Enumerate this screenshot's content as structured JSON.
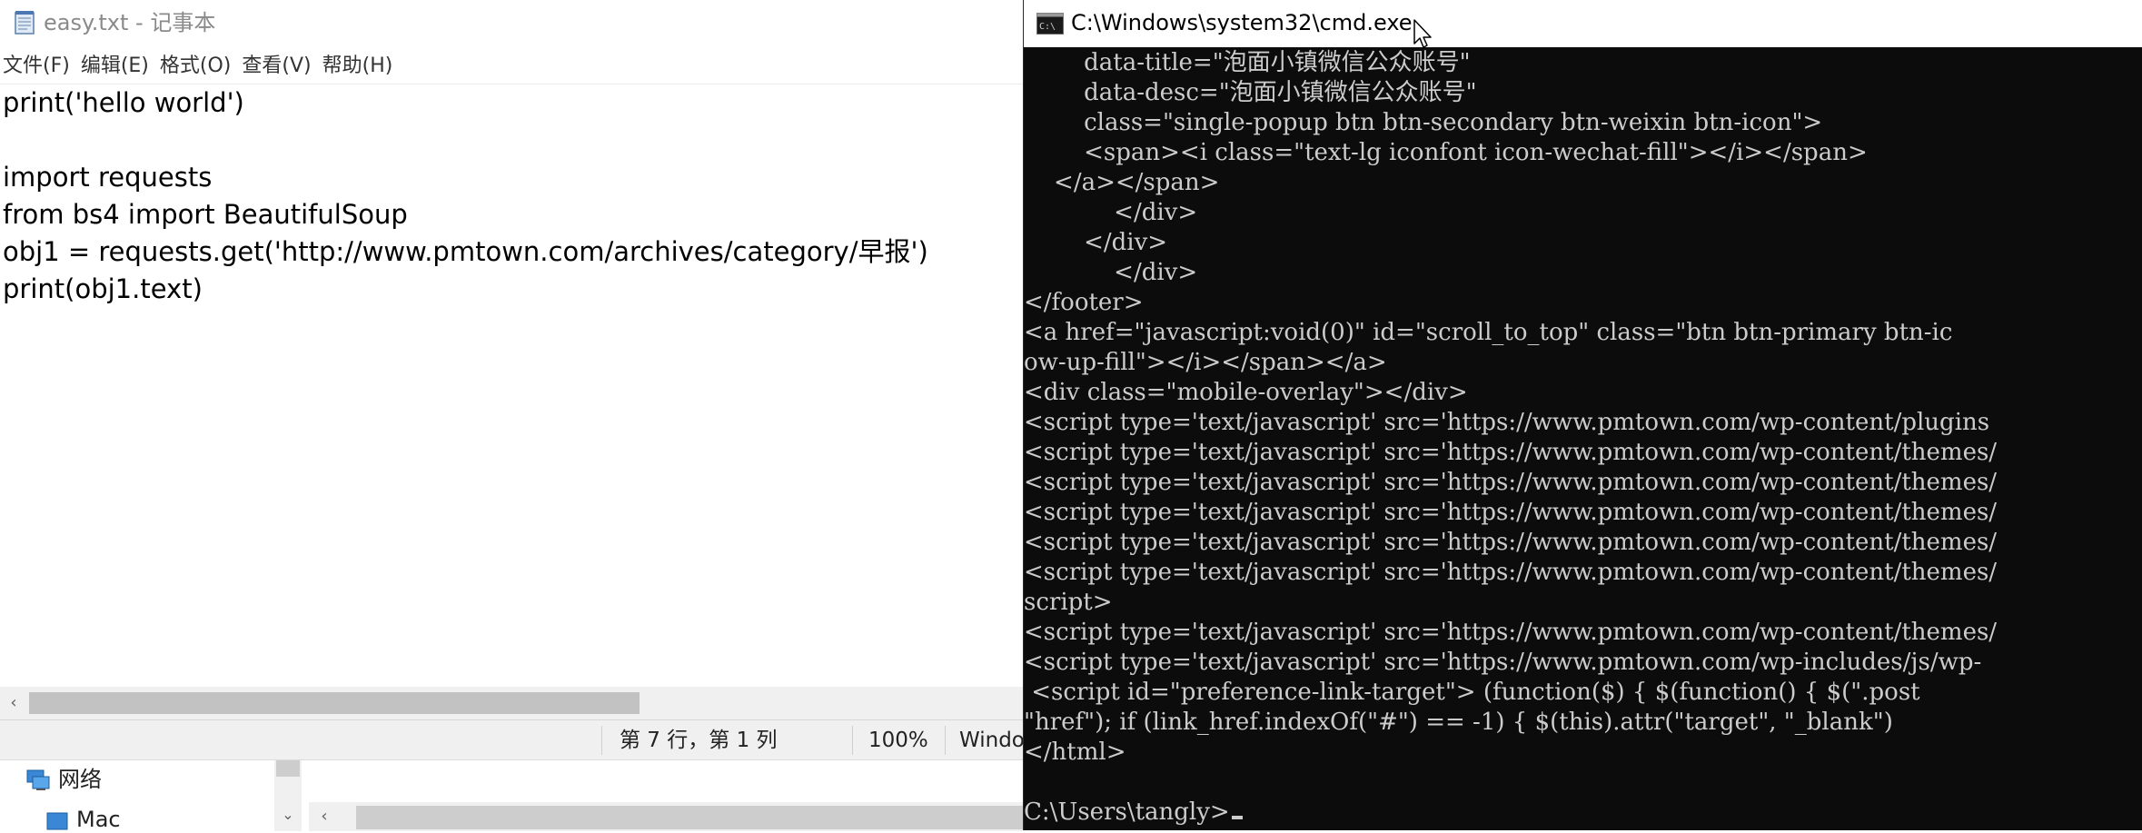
{
  "notepad": {
    "title": "easy.txt - 记事本",
    "menu": [
      "文件(F)",
      "编辑(E)",
      "格式(O)",
      "查看(V)",
      "帮助(H)"
    ],
    "lines": [
      "print('hello world')",
      "",
      "import requests",
      "from bs4 import BeautifulSoup",
      "obj1 = requests.get('http://www.pmtown.com/archives/category/早报')",
      "print(obj1.text)"
    ],
    "status": {
      "position": "第 7 行，第 1 列",
      "zoom": "100%",
      "line_ending": "Windo"
    }
  },
  "explorer": {
    "items": [
      {
        "label": "网络",
        "icon": "network-icon"
      },
      {
        "label": "Mac",
        "icon": "drive-icon"
      }
    ]
  },
  "cmd": {
    "title": "C:\\Windows\\system32\\cmd.exe",
    "lines": [
      "        data-title=\"泡面小镇微信公众账号\"",
      "        data-desc=\"泡面小镇微信公众账号\"",
      "        class=\"single-popup btn btn-secondary btn-weixin btn-icon\">",
      "        <span><i class=\"text-lg iconfont icon-wechat-fill\"></i></span>",
      "    </a></span>",
      "            </div>",
      "        </div>",
      "            </div>",
      "</footer>",
      "<a href=\"javascript:void(0)\" id=\"scroll_to_top\" class=\"btn btn-primary btn-ic",
      "ow-up-fill\"></i></span></a>",
      "<div class=\"mobile-overlay\"></div>",
      "<script type='text/javascript' src='https://www.pmtown.com/wp-content/plugins",
      "<script type='text/javascript' src='https://www.pmtown.com/wp-content/themes/",
      "<script type='text/javascript' src='https://www.pmtown.com/wp-content/themes/",
      "<script type='text/javascript' src='https://www.pmtown.com/wp-content/themes/",
      "<script type='text/javascript' src='https://www.pmtown.com/wp-content/themes/",
      "<script type='text/javascript' src='https://www.pmtown.com/wp-content/themes/",
      "script>",
      "<script type='text/javascript' src='https://www.pmtown.com/wp-content/themes/",
      "<script type='text/javascript' src='https://www.pmtown.com/wp-includes/js/wp-",
      " <script id=\"preference-link-target\"> (function($) { $(function() { $(\".post",
      "\"href\"); if (link_href.indexOf(\"#\") == -1) { $(this).attr(\"target\", \"_blank\")",
      "</html>",
      "",
      "C:\\Users\\tangly>"
    ]
  }
}
